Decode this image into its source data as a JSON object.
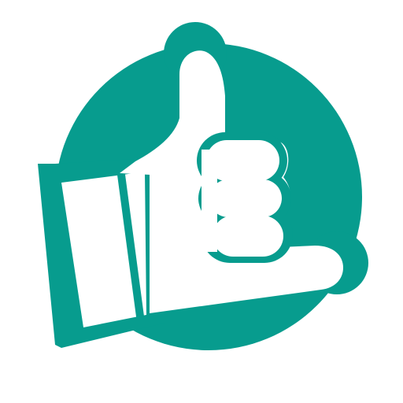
{
  "icon": {
    "name": "shaka-hand-icon",
    "colors": {
      "primary": "#079c8e",
      "background": "#ffffff"
    }
  }
}
